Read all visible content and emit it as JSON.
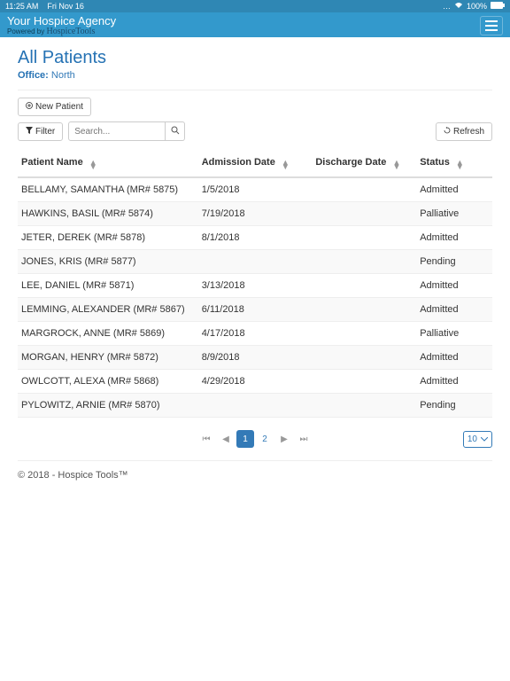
{
  "status_bar": {
    "time": "11:25 AM",
    "date": "Fri Nov 16",
    "battery": "100%"
  },
  "header": {
    "agency_name": "Your Hospice Agency",
    "powered_prefix": "Powered by",
    "powered_logo": "HospiceTools"
  },
  "page": {
    "title": "All Patients",
    "office_label": "Office:",
    "office_value": "North"
  },
  "toolbar": {
    "new_patient": "New Patient",
    "filter": "Filter",
    "refresh": "Refresh",
    "search_placeholder": "Search..."
  },
  "table": {
    "headers": {
      "name": "Patient Name",
      "admission": "Admission Date",
      "discharge": "Discharge Date",
      "status": "Status"
    },
    "rows": [
      {
        "name": "BELLAMY, SAMANTHA (MR# 5875)",
        "admission": "1/5/2018",
        "discharge": "",
        "status": "Admitted"
      },
      {
        "name": "HAWKINS, BASIL (MR# 5874)",
        "admission": "7/19/2018",
        "discharge": "",
        "status": "Palliative"
      },
      {
        "name": "JETER, DEREK (MR# 5878)",
        "admission": "8/1/2018",
        "discharge": "",
        "status": "Admitted"
      },
      {
        "name": "JONES, KRIS (MR# 5877)",
        "admission": "",
        "discharge": "",
        "status": "Pending"
      },
      {
        "name": "LEE, DANIEL (MR# 5871)",
        "admission": "3/13/2018",
        "discharge": "",
        "status": "Admitted"
      },
      {
        "name": "LEMMING, ALEXANDER (MR# 5867)",
        "admission": "6/11/2018",
        "discharge": "",
        "status": "Admitted"
      },
      {
        "name": "MARGROCK, ANNE (MR# 5869)",
        "admission": "4/17/2018",
        "discharge": "",
        "status": "Palliative"
      },
      {
        "name": "MORGAN, HENRY (MR# 5872)",
        "admission": "8/9/2018",
        "discharge": "",
        "status": "Admitted"
      },
      {
        "name": "OWLCOTT, ALEXA (MR# 5868)",
        "admission": "4/29/2018",
        "discharge": "",
        "status": "Admitted"
      },
      {
        "name": "PYLOWITZ, ARNIE (MR# 5870)",
        "admission": "",
        "discharge": "",
        "status": "Pending"
      }
    ]
  },
  "pagination": {
    "pages": [
      "1",
      "2"
    ],
    "active": "1",
    "page_size": "10"
  },
  "footer": "© 2018 - Hospice Tools™"
}
